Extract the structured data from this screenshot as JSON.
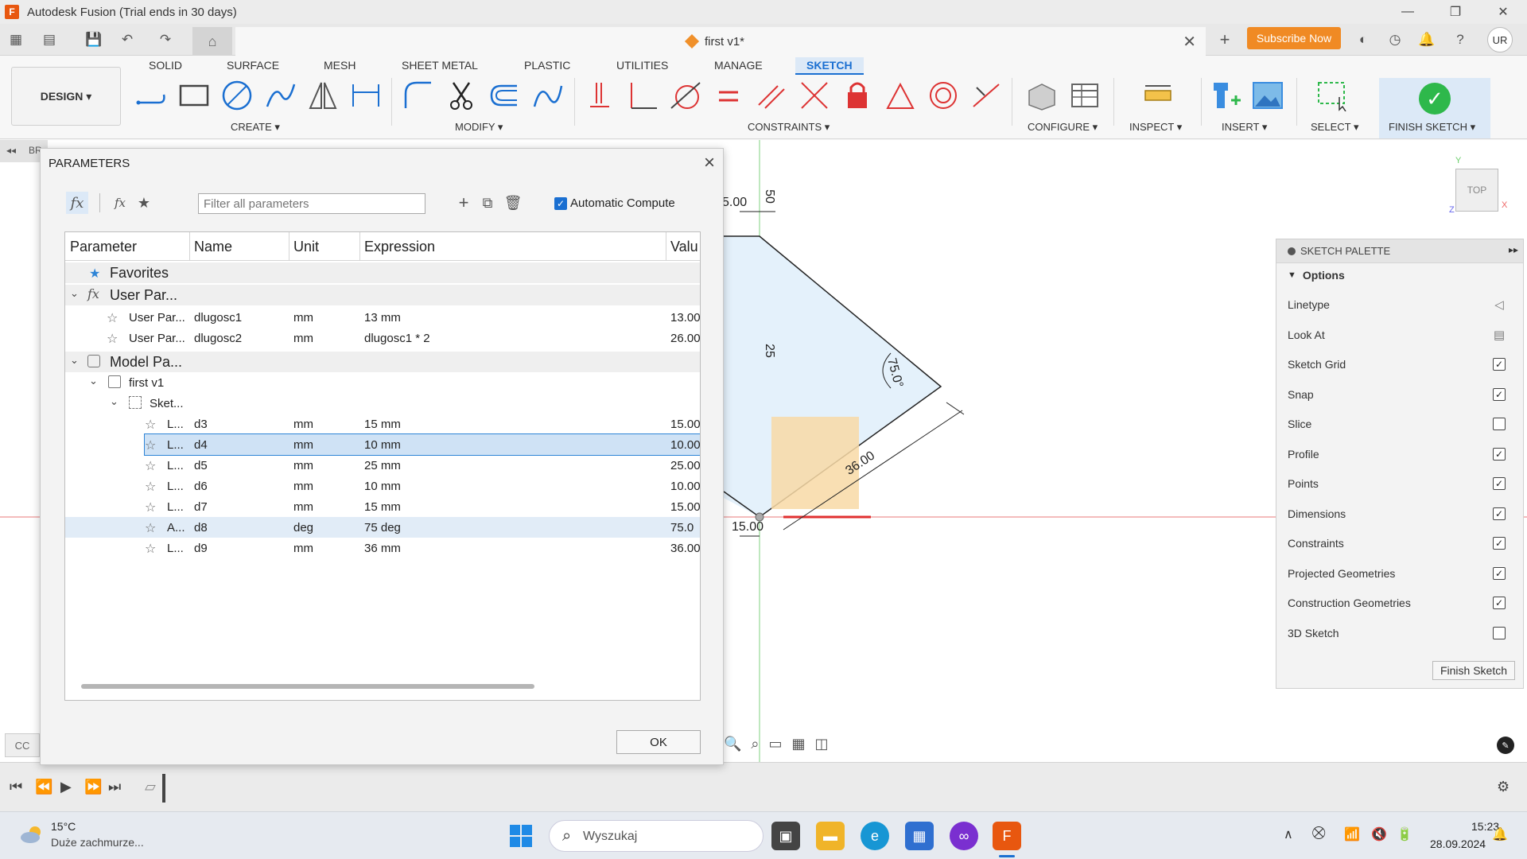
{
  "window": {
    "title": "Autodesk Fusion (Trial ends in 30 days)",
    "logo_letter": "F",
    "doc_tab_title": "first v1*",
    "subscribe_label": "Subscribe Now",
    "user_initials": "UR"
  },
  "ribbon": {
    "workspace": "DESIGN ▾",
    "tabs": [
      "SOLID",
      "SURFACE",
      "MESH",
      "SHEET METAL",
      "PLASTIC",
      "UTILITIES",
      "MANAGE",
      "SKETCH"
    ],
    "active_tab": "SKETCH",
    "groups": [
      "CREATE ▾",
      "MODIFY ▾",
      "CONSTRAINTS ▾",
      "CONFIGURE ▾",
      "INSPECT ▾",
      "INSERT ▾",
      "SELECT ▾"
    ],
    "finish_sketch": "FINISH SKETCH ▾"
  },
  "browser": {
    "label": "BR"
  },
  "viewcube": {
    "face": "TOP",
    "axis_y": "Y",
    "axis_x": "X",
    "axis_z": "Z"
  },
  "sketch": {
    "dim_top_left": "5.00",
    "dim_vertical_top": "50",
    "dim_vertical_mid": "25",
    "dim_angle": "75.0°",
    "dim_diagonal": "36.00",
    "dim_bottom": "15.00"
  },
  "parameters_dialog": {
    "title": "PARAMETERS",
    "filter_placeholder": "Filter all parameters",
    "auto_compute_label": "Automatic Compute",
    "columns": [
      "Parameter",
      "Name",
      "Unit",
      "Expression",
      "Valu"
    ],
    "favorites_label": "Favorites",
    "user_group_label": "User Par...",
    "model_group_label": "Model Pa...",
    "component_label": "first v1",
    "sketch_label": "Sket...",
    "user_params": [
      {
        "param": "User Par...",
        "name": "dlugosc1",
        "unit": "mm",
        "expression": "13 mm",
        "value": "13.00"
      },
      {
        "param": "User Par...",
        "name": "dlugosc2",
        "unit": "mm",
        "expression": "dlugosc1 * 2",
        "value": "26.00"
      }
    ],
    "model_params": [
      {
        "param": "L...",
        "name": "d3",
        "unit": "mm",
        "expression": "15 mm",
        "value": "15.00"
      },
      {
        "param": "L...",
        "name": "d4",
        "unit": "mm",
        "expression": "10 mm",
        "value": "10.00"
      },
      {
        "param": "L...",
        "name": "d5",
        "unit": "mm",
        "expression": "25 mm",
        "value": "25.00"
      },
      {
        "param": "L...",
        "name": "d6",
        "unit": "mm",
        "expression": "10 mm",
        "value": "10.00"
      },
      {
        "param": "L...",
        "name": "d7",
        "unit": "mm",
        "expression": "15 mm",
        "value": "15.00"
      },
      {
        "param": "A...",
        "name": "d8",
        "unit": "deg",
        "expression": "75 deg",
        "value": "75.0"
      },
      {
        "param": "L...",
        "name": "d9",
        "unit": "mm",
        "expression": "36 mm",
        "value": "36.00"
      }
    ],
    "ok_label": "OK"
  },
  "sketch_palette": {
    "title": "SKETCH PALETTE",
    "section": "Options",
    "rows": [
      {
        "label": "Linetype",
        "kind": "icon"
      },
      {
        "label": "Look At",
        "kind": "icon"
      },
      {
        "label": "Sketch Grid",
        "checked": true
      },
      {
        "label": "Snap",
        "checked": true
      },
      {
        "label": "Slice",
        "checked": false
      },
      {
        "label": "Profile",
        "checked": true
      },
      {
        "label": "Points",
        "checked": true
      },
      {
        "label": "Dimensions",
        "checked": true
      },
      {
        "label": "Constraints",
        "checked": true
      },
      {
        "label": "Projected Geometries",
        "checked": true
      },
      {
        "label": "Construction Geometries",
        "checked": true
      },
      {
        "label": "3D Sketch",
        "checked": false
      }
    ],
    "finish_button": "Finish Sketch"
  },
  "taskbar": {
    "weather_temp": "15°C",
    "weather_desc": "Duże zachmurze...",
    "search_label": "Wyszukaj",
    "time": "15:23",
    "date": "28.09.2024"
  },
  "left_partial": {
    "bottom_label": "CC"
  }
}
